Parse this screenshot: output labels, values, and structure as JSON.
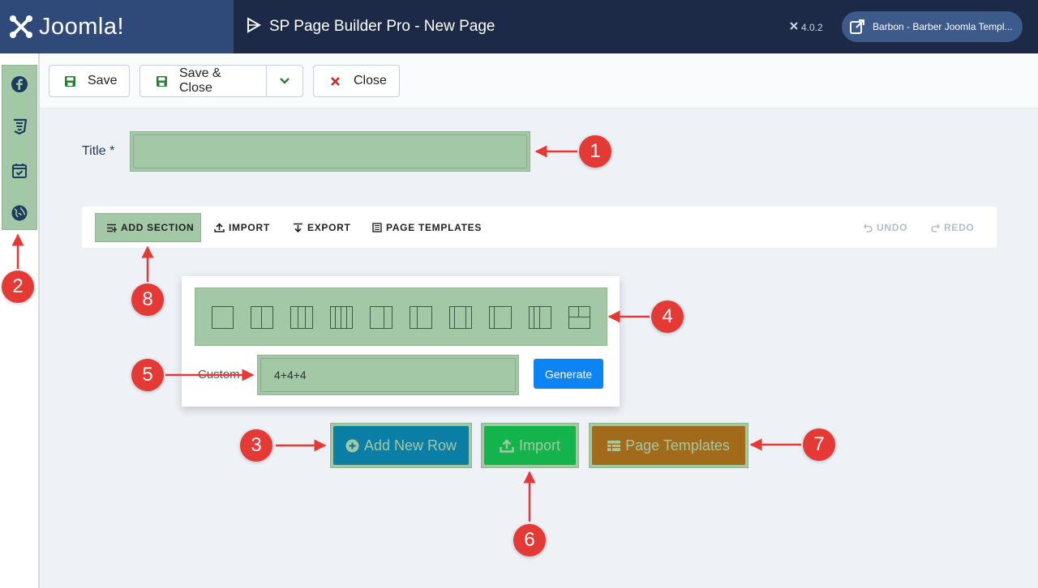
{
  "header": {
    "brand": "Joomla!",
    "page_title": "SP Page Builder Pro - New Page",
    "version": "4.0.2",
    "site_button": "Barbon - Barber Joomla Templ..."
  },
  "sidebar": {
    "icons": [
      "facebook-icon",
      "css3-icon",
      "calendar-check-icon",
      "globe-icon"
    ]
  },
  "toolbar": {
    "save_label": "Save",
    "save_close_label": "Save & Close",
    "close_label": "Close"
  },
  "form": {
    "title_label": "Title *",
    "title_value": ""
  },
  "builder_bar": {
    "add_section": "ADD SECTION",
    "import": "IMPORT",
    "export": "EXPORT",
    "page_templates": "PAGE TEMPLATES",
    "undo": "UNDO",
    "redo": "REDO"
  },
  "popup": {
    "custom_label": "Custom",
    "custom_value": "4+4+4",
    "generate": "Generate"
  },
  "actions": {
    "add_new_row": "Add New Row",
    "import": "Import",
    "page_templates": "Page Templates"
  },
  "callouts": [
    "1",
    "2",
    "3",
    "4",
    "5",
    "6",
    "7",
    "8"
  ],
  "colors": {
    "highlight": "#a3c8a6",
    "callout": "#e53935",
    "header_bg": "#1c2a48",
    "brand_bg": "#2f4a78",
    "add_row_btn": "#0a7ea4",
    "import_btn": "#14b44c",
    "page_templates_btn": "#a26b1c",
    "generate_btn": "#0d84f4"
  }
}
